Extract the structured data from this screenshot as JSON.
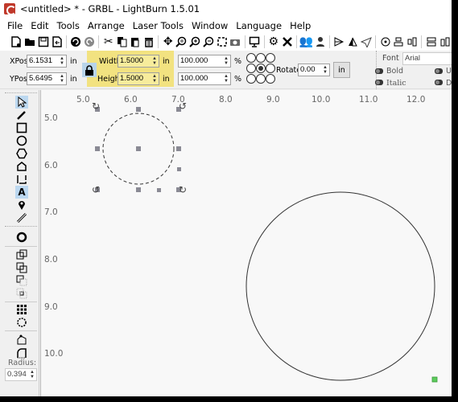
{
  "window": {
    "title": "<untitled> * - GRBL - LightBurn 1.5.01"
  },
  "menu": [
    "File",
    "Edit",
    "Tools",
    "Arrange",
    "Laser Tools",
    "Window",
    "Language",
    "Help"
  ],
  "toolbar": {
    "icons": [
      "new-file-icon",
      "open-folder-icon",
      "save-icon",
      "import-icon",
      "undo-icon",
      "redo-icon",
      "cut-icon",
      "copy-icon",
      "paste-icon",
      "delete-icon",
      "pan-icon",
      "zoom-frame-icon",
      "zoom-in-icon",
      "zoom-out-icon",
      "select-frame-icon",
      "camera-icon",
      "monitor-icon",
      "settings-icon",
      "machine-settings-icon",
      "group-icon",
      "ungroup-icon",
      "mirror-horizontal-icon",
      "mirror-vertical-icon",
      "rotate-icon",
      "center-icon",
      "align-top-icon",
      "align-left-icon",
      "distribute-h-icon",
      "distribute-v-icon"
    ]
  },
  "props": {
    "xpos_label": "XPos",
    "xpos_value": "6.1531",
    "ypos_label": "YPos",
    "ypos_value": "5.6495",
    "unit": "in",
    "width_label": "Width",
    "width_value": "1.5000",
    "height_label": "Height",
    "height_value": "1.5000",
    "scale_w": "100.000",
    "scale_h": "100.000",
    "percent": "%",
    "rotate_label": "Rotate",
    "rotate_value": "0.00",
    "units_button": "in",
    "highlight_color": "#f2e280"
  },
  "font_panel": {
    "font_label": "Font",
    "font_value": "Arial",
    "bold_label": "Bold",
    "italic_label": "Italic",
    "upper_label": "Up",
    "distort_label": "Dis"
  },
  "left_tools": {
    "radius_label": "Radius:",
    "radius_value": "0.394"
  },
  "rulers": {
    "x": [
      "5.0",
      "6.0",
      "7.0",
      "8.0",
      "9.0",
      "10.0",
      "11.0",
      "12.0"
    ],
    "y": [
      "5.0",
      "6.0",
      "7.0",
      "8.0",
      "9.0",
      "10.0"
    ]
  },
  "canvas": {
    "selected_circle": {
      "center_x_in": 6.2,
      "center_y_in": 5.65,
      "diameter_in": 1.5,
      "style": "dashed"
    },
    "large_circle": {
      "center_x_in": 10.5,
      "center_y_in": 8.4,
      "diameter_in": 4.0,
      "style": "solid"
    },
    "origin_marker_color": "#5dcc5d"
  }
}
